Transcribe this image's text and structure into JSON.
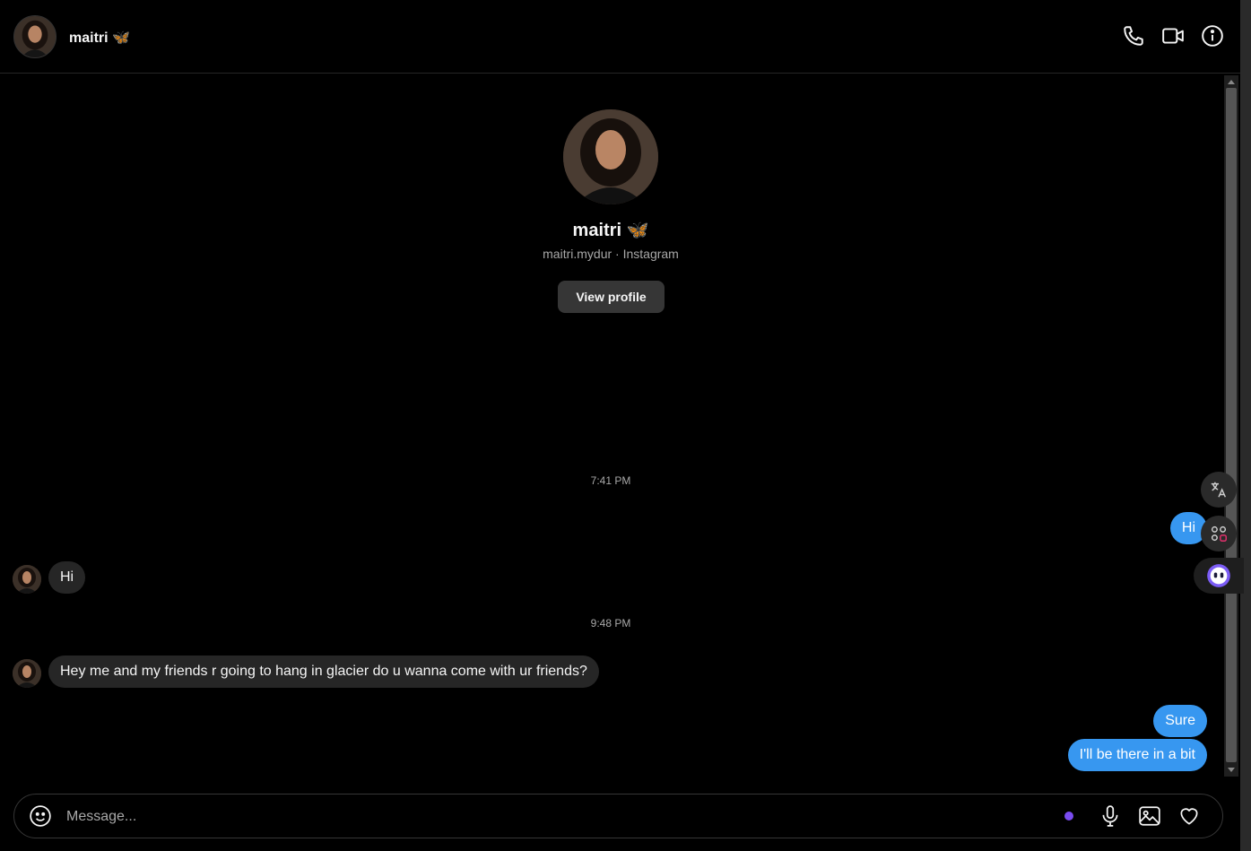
{
  "header": {
    "name": "maitri 🦋",
    "actions": [
      "phone-icon",
      "video-icon",
      "info-icon"
    ]
  },
  "profile": {
    "name": "maitri 🦋",
    "subtitle": "maitri.mydur · Instagram",
    "view_profile_label": "View profile"
  },
  "messages": [
    {
      "type": "time",
      "text": "7:41 PM"
    },
    {
      "type": "out",
      "text": "Hi"
    },
    {
      "type": "in",
      "text": "Hi"
    },
    {
      "type": "time",
      "text": "9:48 PM"
    },
    {
      "type": "in",
      "text": "Hey me and my friends r going to hang in glacier do u wanna come with ur friends?"
    },
    {
      "type": "out",
      "text": "Sure"
    },
    {
      "type": "out",
      "text": "I'll be there in a bit"
    }
  ],
  "side_tools": [
    "translate-icon",
    "apps-icon",
    "assistant-icon"
  ],
  "composer": {
    "placeholder": "Message...",
    "tools": [
      "microphone-icon",
      "image-icon",
      "heart-icon"
    ]
  },
  "colors": {
    "background": "#000000",
    "outgoing_bubble": "#3797f0",
    "incoming_bubble": "#262626",
    "button": "#363636",
    "muted_text": "#a8a8a8"
  }
}
